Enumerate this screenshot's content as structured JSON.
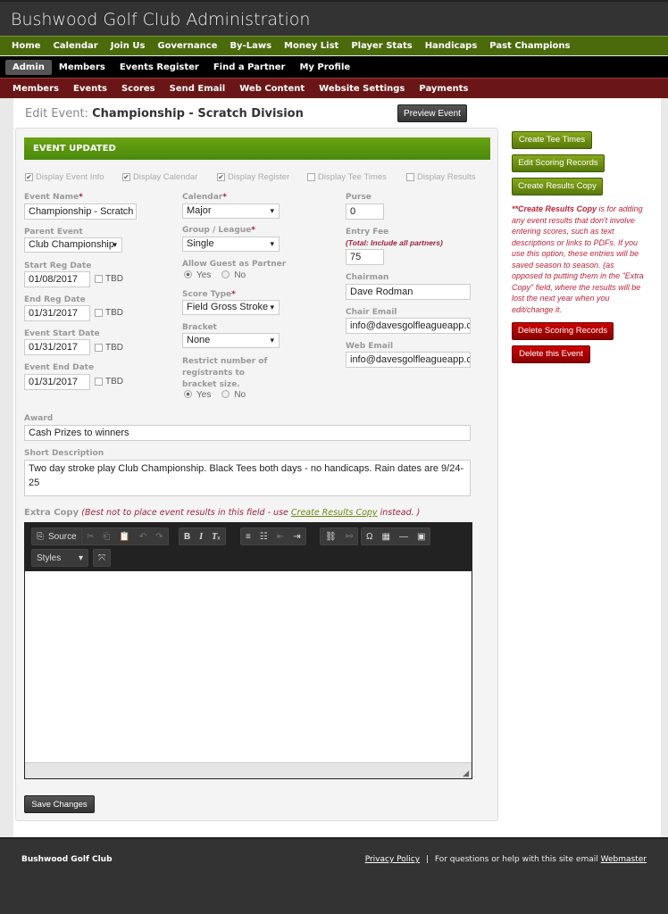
{
  "app_title": "Bushwood Golf Club Administration",
  "nav_main": [
    "Home",
    "Calendar",
    "Join Us",
    "Governance",
    "By-Laws",
    "Money List",
    "Player Stats",
    "Handicaps",
    "Past Champions"
  ],
  "nav_user": [
    "Admin",
    "Members",
    "Events Register",
    "Find a Partner",
    "My Profile"
  ],
  "nav_admin": [
    "Members",
    "Events",
    "Scores",
    "Send Email",
    "Web Content",
    "Website Settings",
    "Payments"
  ],
  "page": {
    "label": "Edit Event:",
    "event_name": "Championship - Scratch Division",
    "preview_button": "Preview Event"
  },
  "banner": "EVENT UPDATED",
  "display_options": [
    {
      "label": "Display Event Info",
      "checked": true
    },
    {
      "label": "Display Calendar",
      "checked": true
    },
    {
      "label": "Display Register",
      "checked": true
    },
    {
      "label": "Display Tee Times",
      "checked": false
    },
    {
      "label": "Display Results",
      "checked": false
    }
  ],
  "form": {
    "event_name": {
      "label": "Event Name",
      "value": "Championship - Scratch D"
    },
    "parent_event": {
      "label": "Parent Event",
      "value": "Club Championship"
    },
    "start_reg": {
      "label": "Start Reg Date",
      "value": "01/08/2017",
      "tbd": "TBD"
    },
    "end_reg": {
      "label": "End Reg Date",
      "value": "01/31/2017",
      "tbd": "TBD"
    },
    "event_start": {
      "label": "Event Start Date",
      "value": "01/31/2017",
      "tbd": "TBD"
    },
    "event_end": {
      "label": "Event End Date",
      "value": "01/31/2017",
      "tbd": "TBD"
    },
    "calendar": {
      "label": "Calendar",
      "value": "Major"
    },
    "group": {
      "label": "Group / League",
      "value": "Single"
    },
    "allow_guest": {
      "label": "Allow Guest as Partner",
      "yes": "Yes",
      "no": "No",
      "selected": "Yes"
    },
    "score_type": {
      "label": "Score Type",
      "value": "Field Gross Stroke"
    },
    "bracket": {
      "label": "Bracket",
      "value": "None"
    },
    "restrict": {
      "label": "Restrict number of registrants to bracket size.",
      "yes": "Yes",
      "no": "No",
      "selected": "Yes"
    },
    "purse": {
      "label": "Purse",
      "value": "0"
    },
    "entry_fee": {
      "label": "Entry Fee",
      "note": "(Total: Include all partners)",
      "value": "75"
    },
    "chairman": {
      "label": "Chairman",
      "value": "Dave Rodman"
    },
    "chair_email": {
      "label": "Chair Email",
      "value": "info@davesgolfleagueapp.co"
    },
    "web_email": {
      "label": "Web Email",
      "value": "info@davesgolfleagueapp.co"
    },
    "award": {
      "label": "Award",
      "value": "Cash Prizes to winners"
    },
    "short_desc": {
      "label": "Short Description",
      "value": "Two day stroke play Club Championship. Black Tees both days - no handicaps.  Rain dates are 9/24-25"
    },
    "extra_copy": {
      "label": "Extra Copy",
      "note_pre": "(Best not to place event results in this field - use ",
      "note_link": "Create Results Copy",
      "note_post": " instead. )"
    },
    "save_button": "Save Changes"
  },
  "editor": {
    "source": "Source",
    "styles": "Styles"
  },
  "side": {
    "create_tee_times": "Create Tee Times",
    "edit_scoring": "Edit Scoring Records",
    "create_results": "Create Results Copy",
    "note_bold": "**Create Results Copy",
    "note_text": " is for adding any event results that don't involve entering scores, such as text descriptions or links to PDFs. If you use this option, these entries will be saved season to season. (as opposed to putting them in the \"Extra Copy\" field, where the results will be lost the next year when you edit/change it.",
    "delete_scoring": "Delete Scoring Records",
    "delete_event": "Delete this Event"
  },
  "footer": {
    "club": "Bushwood Golf Club",
    "privacy": "Privacy Policy",
    "sep": "|",
    "help": "For questions or help with this site email",
    "webmaster": "Webmaster"
  },
  "colors": {
    "green_nav": "#4b6a0c",
    "maroon_nav": "#6b1616",
    "accent_red": "#c0243a"
  }
}
